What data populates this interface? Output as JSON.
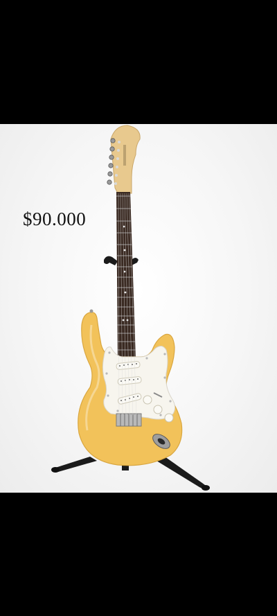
{
  "price_label": "$90.000",
  "photo": {
    "subject": "guitar-photo",
    "background_color": "#f4f4f4",
    "body_color": "#f2c25a",
    "pickguard_color": "#f7f5ee",
    "neck_color": "#e8c98e",
    "fretboard_color": "#3a2a22",
    "stand_color": "#1a1a1a"
  },
  "letterbox_color": "#000000"
}
